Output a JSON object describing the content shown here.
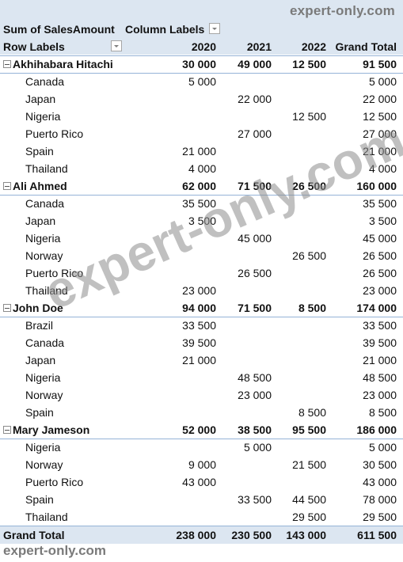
{
  "watermark": "expert-only.com",
  "pivot": {
    "value_field": "Sum of SalesAmount",
    "column_labels": "Column Labels",
    "row_labels": "Row Labels",
    "columns": [
      "2020",
      "2021",
      "2022",
      "Grand Total"
    ],
    "groups": [
      {
        "name": "Akhihabara Hitachi",
        "totals": [
          "30 000",
          "49 000",
          "12 500",
          "91 500"
        ],
        "items": [
          {
            "name": "Canada",
            "values": [
              "5 000",
              "",
              "",
              "5 000"
            ]
          },
          {
            "name": "Japan",
            "values": [
              "",
              "22 000",
              "",
              "22 000"
            ]
          },
          {
            "name": "Nigeria",
            "values": [
              "",
              "",
              "12 500",
              "12 500"
            ]
          },
          {
            "name": "Puerto Rico",
            "values": [
              "",
              "27 000",
              "",
              "27 000"
            ]
          },
          {
            "name": "Spain",
            "values": [
              "21 000",
              "",
              "",
              "21 000"
            ]
          },
          {
            "name": "Thailand",
            "values": [
              "4 000",
              "",
              "",
              "4 000"
            ]
          }
        ]
      },
      {
        "name": "Ali Ahmed",
        "totals": [
          "62 000",
          "71 500",
          "26 500",
          "160 000"
        ],
        "items": [
          {
            "name": "Canada",
            "values": [
              "35 500",
              "",
              "",
              "35 500"
            ]
          },
          {
            "name": "Japan",
            "values": [
              "3 500",
              "",
              "",
              "3 500"
            ]
          },
          {
            "name": "Nigeria",
            "values": [
              "",
              "45 000",
              "",
              "45 000"
            ]
          },
          {
            "name": "Norway",
            "values": [
              "",
              "",
              "26 500",
              "26 500"
            ]
          },
          {
            "name": "Puerto Rico",
            "values": [
              "",
              "26 500",
              "",
              "26 500"
            ]
          },
          {
            "name": "Thailand",
            "values": [
              "23 000",
              "",
              "",
              "23 000"
            ]
          }
        ]
      },
      {
        "name": "John Doe",
        "totals": [
          "94 000",
          "71 500",
          "8 500",
          "174 000"
        ],
        "items": [
          {
            "name": "Brazil",
            "values": [
              "33 500",
              "",
              "",
              "33 500"
            ]
          },
          {
            "name": "Canada",
            "values": [
              "39 500",
              "",
              "",
              "39 500"
            ]
          },
          {
            "name": "Japan",
            "values": [
              "21 000",
              "",
              "",
              "21 000"
            ]
          },
          {
            "name": "Nigeria",
            "values": [
              "",
              "48 500",
              "",
              "48 500"
            ]
          },
          {
            "name": "Norway",
            "values": [
              "",
              "23 000",
              "",
              "23 000"
            ]
          },
          {
            "name": "Spain",
            "values": [
              "",
              "",
              "8 500",
              "8 500"
            ]
          }
        ]
      },
      {
        "name": "Mary Jameson",
        "totals": [
          "52 000",
          "38 500",
          "95 500",
          "186 000"
        ],
        "items": [
          {
            "name": "Nigeria",
            "values": [
              "",
              "5 000",
              "",
              "5 000"
            ]
          },
          {
            "name": "Norway",
            "values": [
              "9 000",
              "",
              "21 500",
              "30 500"
            ]
          },
          {
            "name": "Puerto Rico",
            "values": [
              "43 000",
              "",
              "",
              "43 000"
            ]
          },
          {
            "name": "Spain",
            "values": [
              "",
              "33 500",
              "44 500",
              "78 000"
            ]
          },
          {
            "name": "Thailand",
            "values": [
              "",
              "",
              "29 500",
              "29 500"
            ]
          }
        ]
      }
    ],
    "grand_total": {
      "label": "Grand Total",
      "values": [
        "238 000",
        "230 500",
        "143 000",
        "611 500"
      ]
    }
  }
}
